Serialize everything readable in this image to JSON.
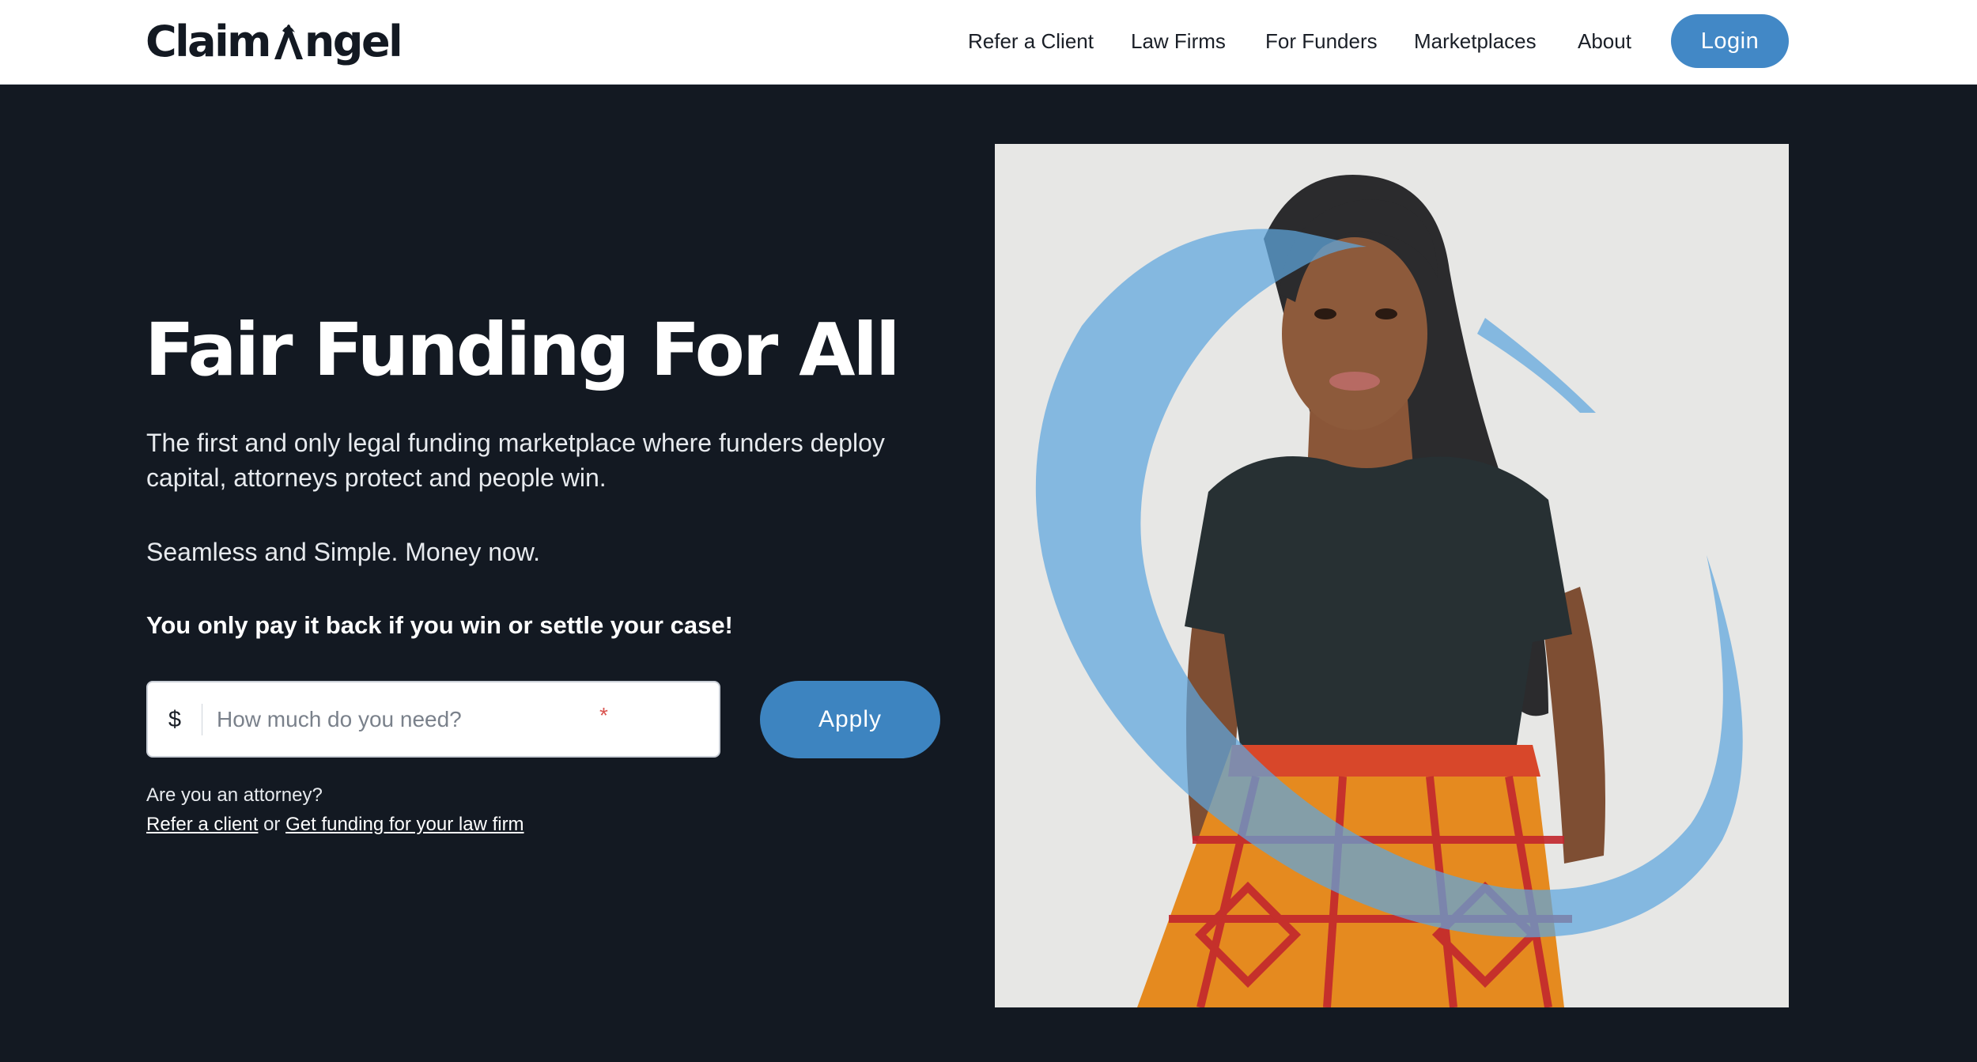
{
  "header": {
    "logo_text_left": "Claim",
    "logo_text_right": "ngel",
    "nav": [
      {
        "label": "Refer a Client"
      },
      {
        "label": "Law Firms"
      },
      {
        "label": "For Funders"
      },
      {
        "label": "Marketplaces"
      },
      {
        "label": "About"
      }
    ],
    "login_label": "Login"
  },
  "hero": {
    "title": "Fair Funding For All",
    "description": "The first and only legal funding marketplace where funders deploy capital, attorneys protect and people win.",
    "subline": "Seamless and Simple. Money now.",
    "bold_line": "You only pay it back if you win or settle your case!",
    "amount_field": {
      "currency": "$",
      "placeholder": "How much do you need?",
      "required_mark": "*",
      "value": ""
    },
    "apply_label": "Apply",
    "attorney_question": "Are you an attorney?",
    "refer_link": "Refer a client",
    "or_text": "or",
    "law_firm_link": "Get funding for your law firm"
  },
  "colors": {
    "background": "#131922",
    "accent": "#4288c6",
    "header_bg": "#ffffff"
  },
  "icons": {
    "logo_mark": "angel-a-logo-icon",
    "photo_swoosh": "blue-swoosh-graphic"
  }
}
